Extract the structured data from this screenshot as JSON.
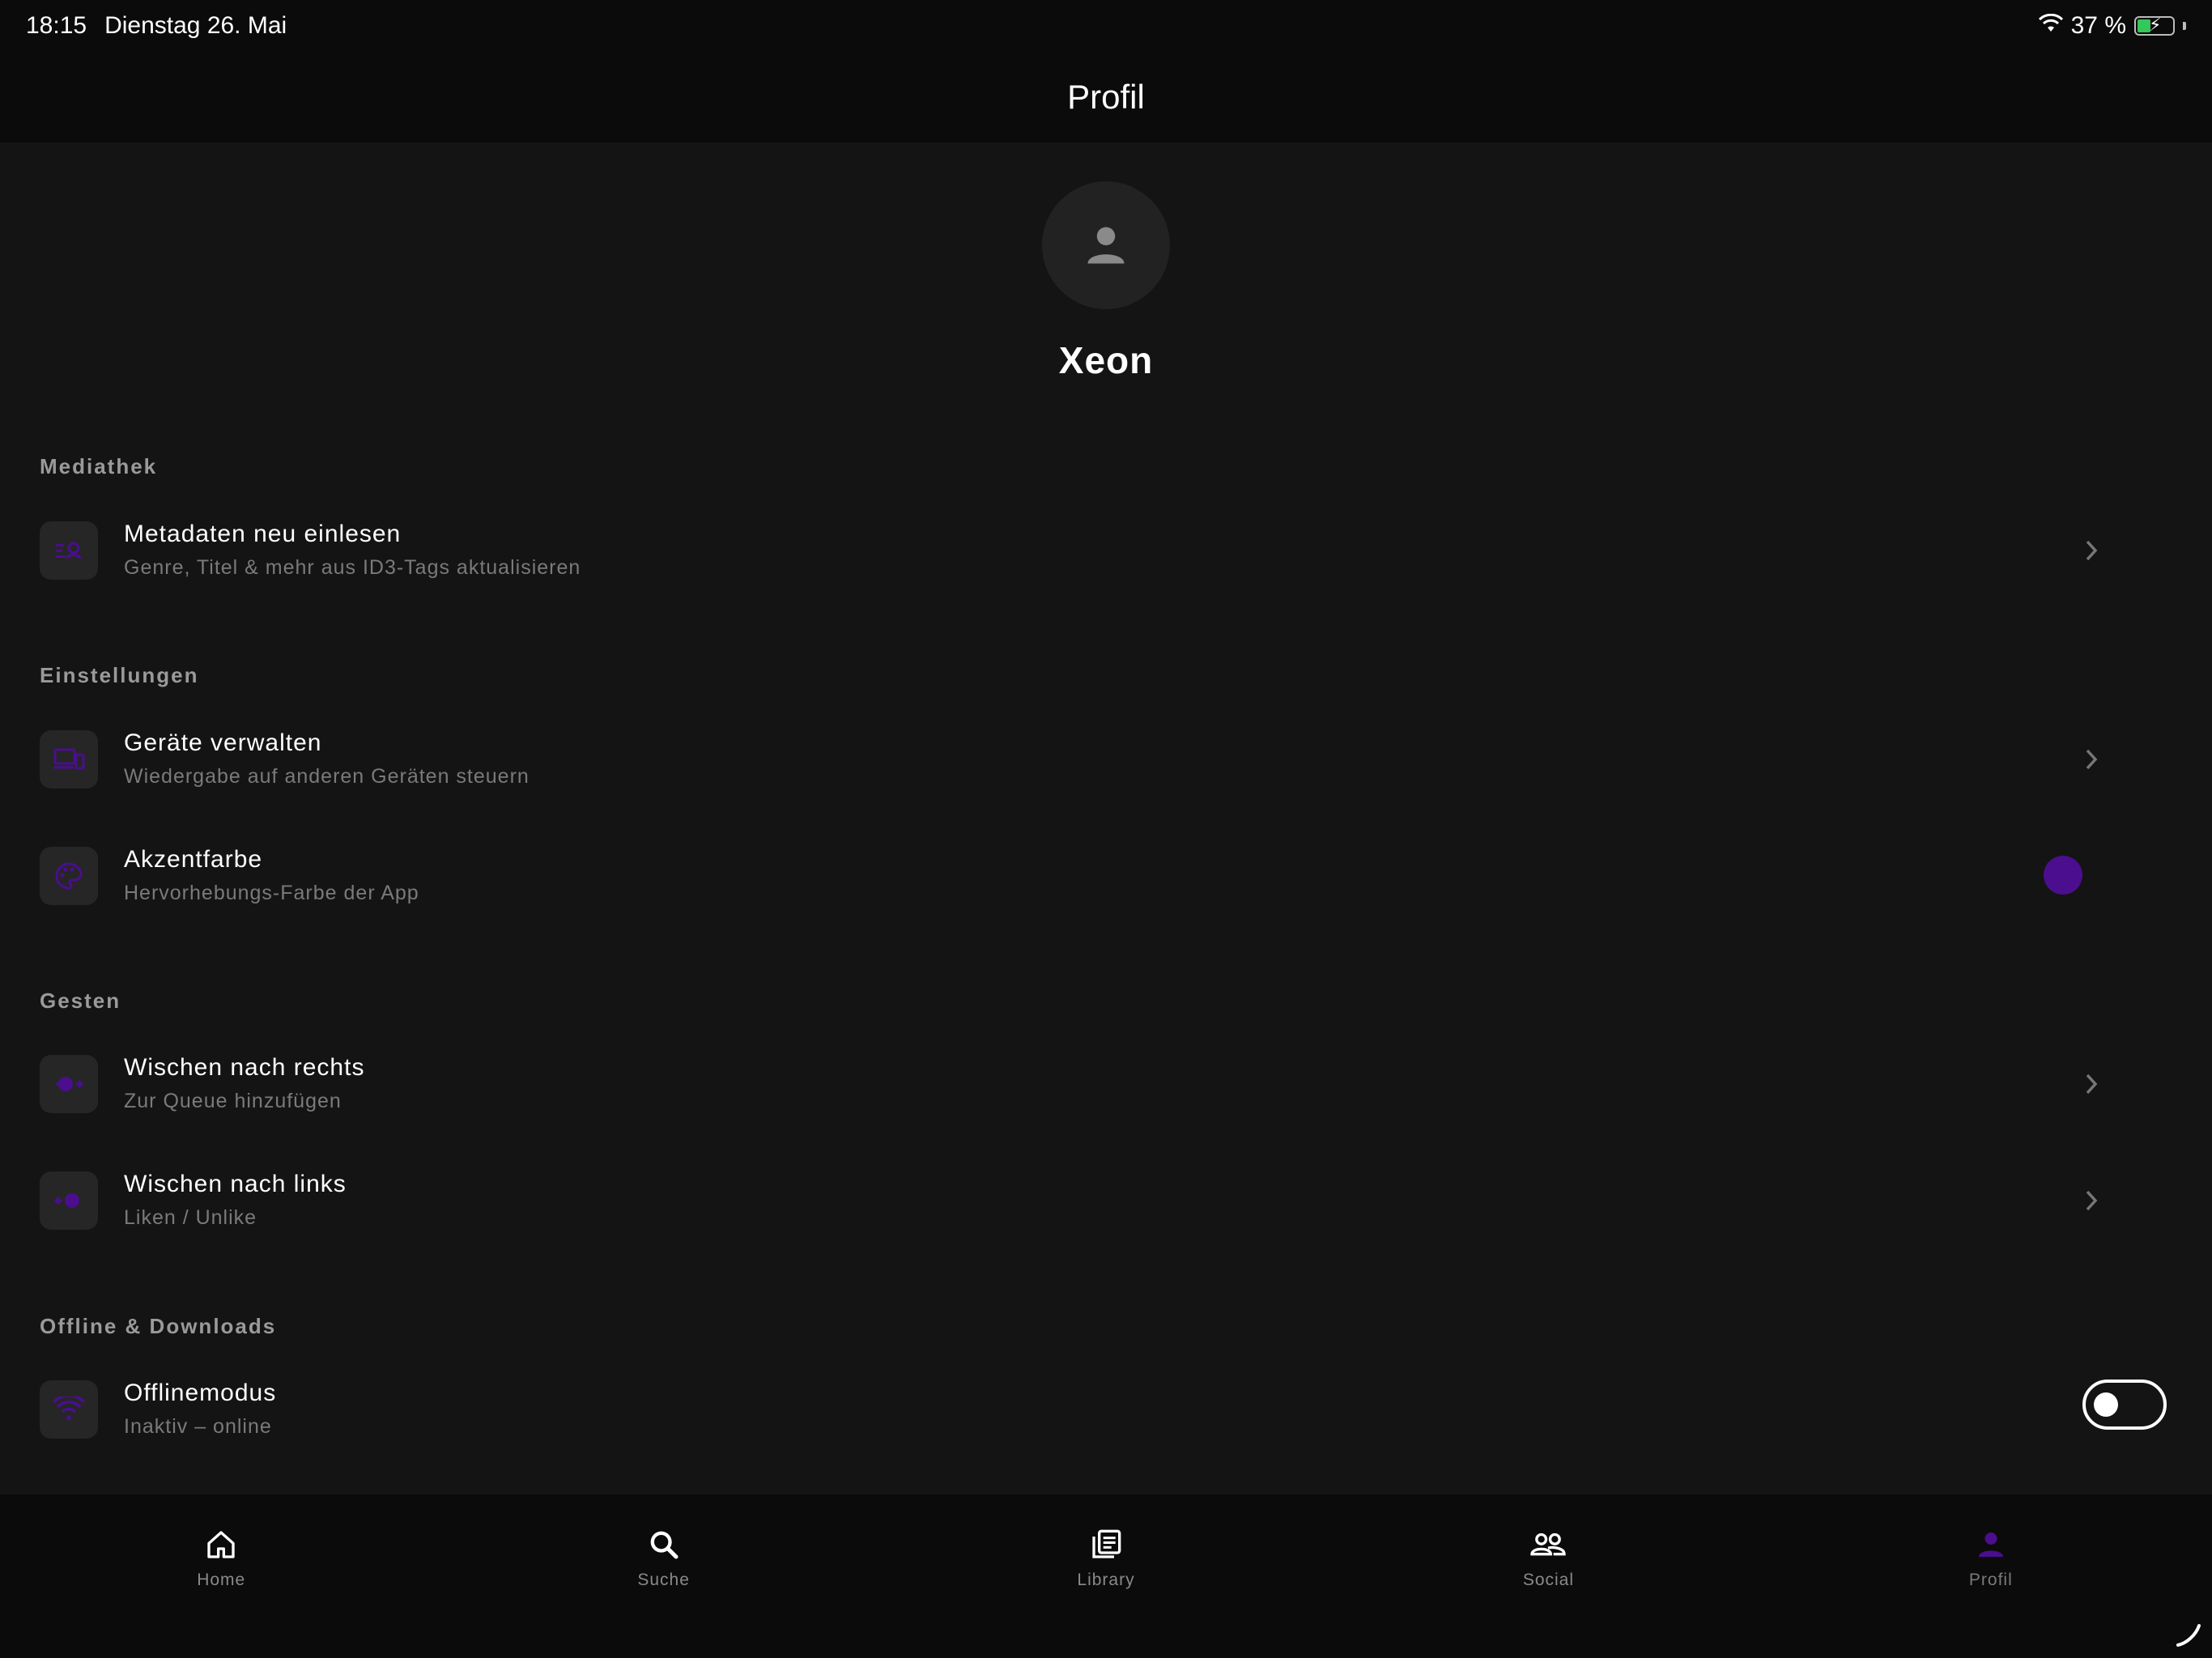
{
  "status": {
    "time": "18:15",
    "date": "Dienstag 26. Mai",
    "battery": "37 %",
    "battery_level": 0.37
  },
  "header": {
    "title": "Profil"
  },
  "profile": {
    "name": "Xeon"
  },
  "accent_color": "#4a0e8f",
  "sections": {
    "mediathek": {
      "label": "Mediathek",
      "items": [
        {
          "title": "Metadaten neu einlesen",
          "subtitle": "Genre, Titel & mehr aus ID3-Tags aktualisieren",
          "icon": "scan-metadata-icon"
        }
      ]
    },
    "einstellungen": {
      "label": "Einstellungen",
      "items": [
        {
          "title": "Geräte verwalten",
          "subtitle": "Wiedergabe auf anderen Geräten steuern",
          "icon": "devices-icon"
        },
        {
          "title": "Akzentfarbe",
          "subtitle": "Hervorhebungs-Farbe der App",
          "icon": "palette-icon"
        }
      ]
    },
    "gesten": {
      "label": "Gesten",
      "items": [
        {
          "title": "Wischen nach rechts",
          "subtitle": "Zur Queue hinzufügen",
          "icon": "swipe-right-icon"
        },
        {
          "title": "Wischen nach links",
          "subtitle": "Liken / Unlike",
          "icon": "swipe-left-icon"
        }
      ]
    },
    "offline": {
      "label": "Offline & Downloads",
      "items": [
        {
          "title": "Offlinemodus",
          "subtitle": "Inaktiv – online",
          "icon": "wifi-icon",
          "toggle_on": false
        }
      ]
    }
  },
  "tabs": [
    {
      "label": "Home",
      "icon": "home-icon",
      "active": false
    },
    {
      "label": "Suche",
      "icon": "search-icon",
      "active": false
    },
    {
      "label": "Library",
      "icon": "library-icon",
      "active": false
    },
    {
      "label": "Social",
      "icon": "social-icon",
      "active": false
    },
    {
      "label": "Profil",
      "icon": "person-icon",
      "active": true
    }
  ]
}
